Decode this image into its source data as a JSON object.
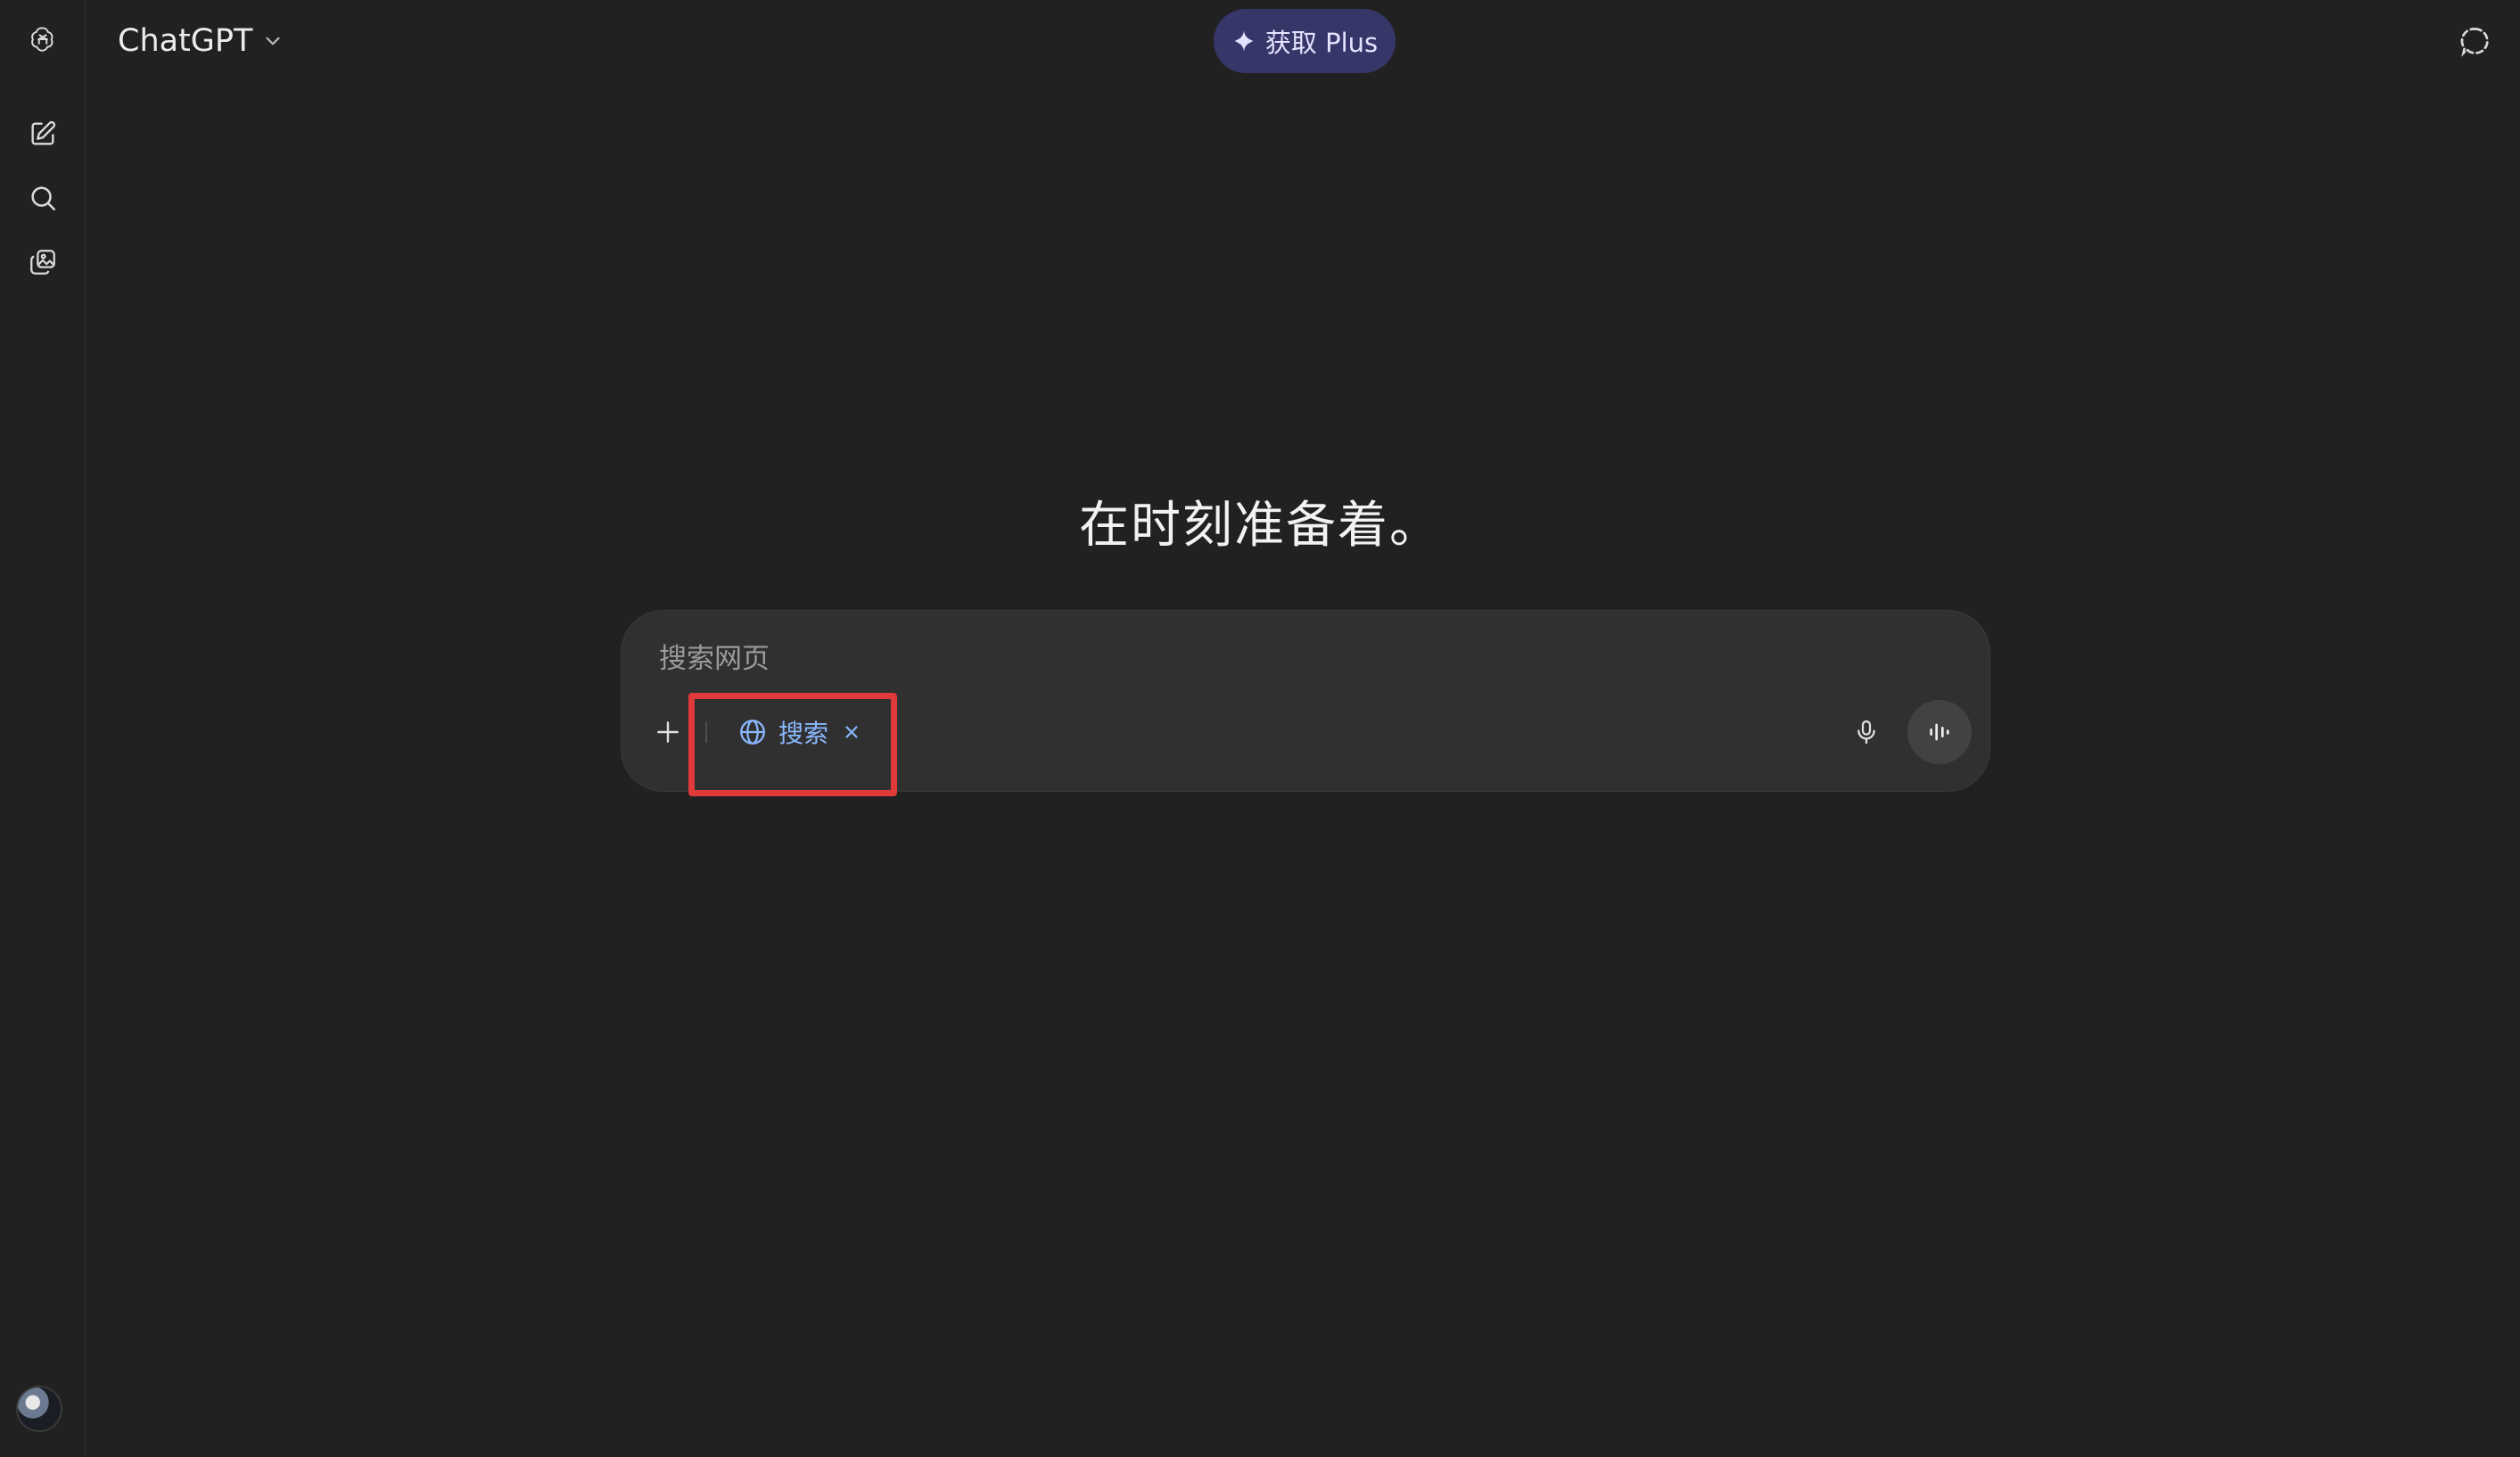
{
  "header": {
    "model_name": "ChatGPT",
    "upgrade_label": "获取 Plus"
  },
  "sidebar": {
    "icons": [
      "openai-logo-icon",
      "new-chat-icon",
      "search-icon",
      "library-icon"
    ]
  },
  "main": {
    "headline": "在时刻准备着。"
  },
  "composer": {
    "placeholder": "搜索网页",
    "value": "",
    "tool_pill": {
      "label": "搜索",
      "icon": "globe-icon",
      "close_icon": "close-icon"
    }
  },
  "colors": {
    "background": "#212121",
    "composer_bg": "#303030",
    "upgrade_bg": "#373669",
    "pill_text": "#8ab8ff",
    "highlight": "#e03a3a"
  }
}
